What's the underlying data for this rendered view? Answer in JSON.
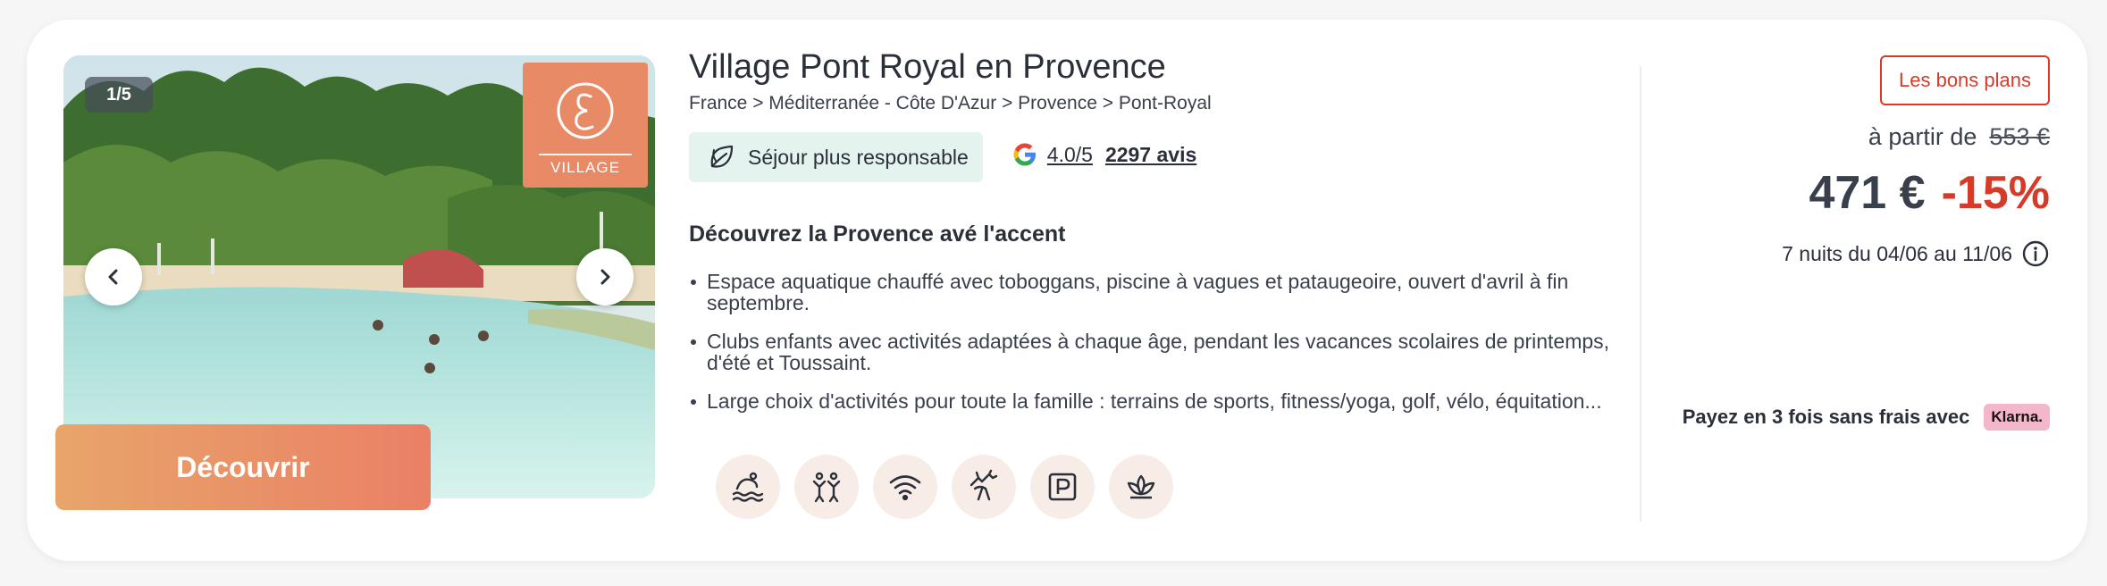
{
  "gallery": {
    "counter": "1/5",
    "brand_text": "VILLAGE"
  },
  "listing": {
    "title": "Village Pont Royal en Provence",
    "breadcrumb": "France > Méditerranée - Côte D'Azur > Provence > Pont-Royal",
    "eco_badge": "Séjour plus responsable",
    "rating": "4.0/5",
    "reviews": "2297 avis",
    "tagline": "Découvrez la Provence avé l'accent",
    "features": [
      "Espace aquatique chauffé avec toboggans, piscine à vagues et pataugeoire, ouvert d'avril à fin septembre.",
      "Clubs enfants avec activités adaptées à chaque âge, pendant les vacances scolaires de printemps, d'été et Toussaint.",
      "Large choix d'activités pour toute la famille : terrains de sports, fitness/yoga, golf, vélo, équitation..."
    ],
    "amenity_icons": [
      "water-park-icon",
      "kids-club-icon",
      "wifi-icon",
      "horse-riding-icon",
      "parking-icon",
      "spa-icon"
    ]
  },
  "pricing": {
    "deal_badge": "Les bons plans",
    "from_label": "à partir de",
    "old_price": "553 €",
    "price": "471 €",
    "discount": "-15%",
    "dates": "7 nuits du 04/06 au 11/06",
    "installments": "Payez en 3 fois sans frais avec",
    "klarna": "Klarna.",
    "cta": "Découvrir"
  },
  "colors": {
    "accent_orange": "#e98a67",
    "discount_red": "#d63b2a",
    "eco_green_bg": "#e4f3ee",
    "amenity_bg": "#f7ece6"
  }
}
